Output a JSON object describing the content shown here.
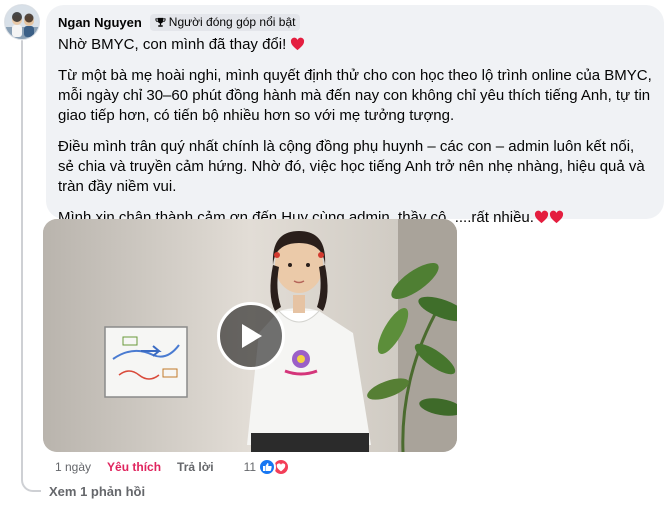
{
  "comment": {
    "author": "Ngan Nguyen",
    "badge_label": "Người đóng góp nổi bật",
    "badge_icon": "trophy-icon",
    "paragraphs": [
      "Nhờ BMYC, con mình đã thay đổi!",
      "Từ một bà mẹ hoài nghi, mình quyết định thử cho con học theo lộ trình online của BMYC, mỗi ngày chỉ 30–60 phút đồng hành mà đến nay con không chỉ yêu thích tiếng Anh, tự tin giao tiếp hơn, có tiến bộ nhiều hơn so với mẹ tưởng tượng.",
      "Điều mình trân quý nhất chính là cộng đồng phụ huynh – các con – admin luôn kết nối, sẻ chia và truyền cảm hứng. Nhờ đó, việc học tiếng Anh trở nên nhẹ nhàng, hiệu quả và tràn đầy niềm vui.",
      "Mình xin chân thành cảm ơn đến Huy cùng admin, thầy cô, ....rất nhiều."
    ],
    "heart_color": "#e41e3f"
  },
  "video": {
    "play_icon": "play-icon"
  },
  "actions": {
    "time": "1 ngày",
    "like_label": "Yêu thích",
    "reply_label": "Trả lời",
    "reaction_count": "11",
    "like_color": "#1877f2",
    "love_color": "#f33e58",
    "liked_color": "#e0245e"
  },
  "replies": {
    "label": "Xem 1 phản hồi"
  }
}
